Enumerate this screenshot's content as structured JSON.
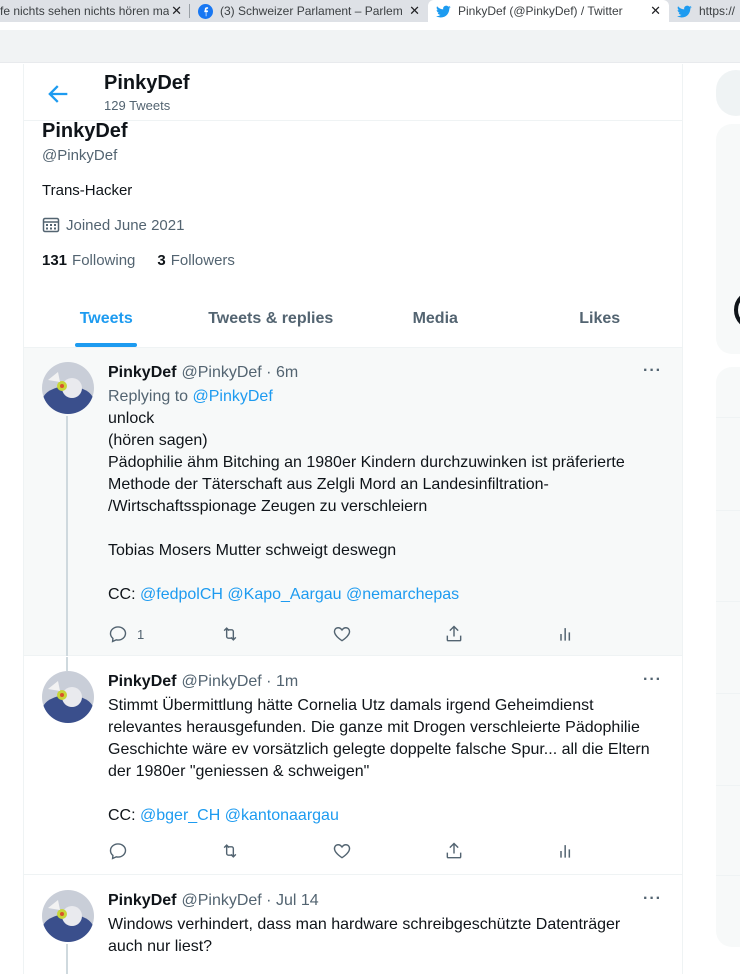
{
  "browser": {
    "tabs": [
      {
        "title": "fe nichts sehen nichts hören ma",
        "active": false
      },
      {
        "title": "(3) Schweizer Parlament – Parlem",
        "active": false,
        "icon": "facebook-icon"
      },
      {
        "title": "PinkyDef (@PinkyDef) / Twitter",
        "active": true,
        "icon": "twitter-icon"
      },
      {
        "title": "https://",
        "active": false,
        "icon": "twitter-icon"
      }
    ]
  },
  "header": {
    "name": "PinkyDef",
    "tweet_count": "129 Tweets"
  },
  "profile": {
    "name": "PinkyDef",
    "handle": "@PinkyDef",
    "bio": "Trans-Hacker",
    "joined": "Joined June 2021",
    "following_count": "131",
    "following_label": "Following",
    "followers_count": "3",
    "followers_label": "Followers"
  },
  "tabs": [
    "Tweets",
    "Tweets & replies",
    "Media",
    "Likes"
  ],
  "tweets": [
    {
      "name": "PinkyDef",
      "meta": "@PinkyDef · 6m",
      "replying_prefix": "Replying to ",
      "replying_to": "@PinkyDef",
      "lines": [
        "unlock",
        "(hören sagen)",
        "Pädophilie ähm Bitching an 1980er Kindern durchzuwinken ist präferierte",
        "Methode der Täterschaft aus Zelgli Mord an Landesinfiltration-",
        "/Wirtschaftsspionage Zeugen zu verschleiern",
        "",
        "Tobias Mosers Mutter schweigt deswegn",
        ""
      ],
      "cc_prefix": "CC: ",
      "mentions": [
        "@fedpolCH",
        "@Kapo_Aargau",
        "@nemarchepas"
      ],
      "reply_count": "1"
    },
    {
      "name": "PinkyDef",
      "meta": "@PinkyDef · 1m",
      "lines": [
        "Stimmt Übermittlung hätte Cornelia Utz damals irgend Geheimdienst",
        "relevantes herausgefunden. Die ganze mit Drogen verschleierte Pädophilie",
        "Geschichte wäre ev vorsätzlich gelegte doppelte falsche Spur... all die Eltern",
        "der 1980er \"geniessen & schweigen\"",
        ""
      ],
      "cc_prefix": "CC: ",
      "mentions": [
        "@bger_CH",
        "@kantonaargau"
      ]
    },
    {
      "name": "PinkyDef",
      "meta": "@PinkyDef · Jul 14",
      "lines": [
        "Windows verhindert, dass man hardware schreibgeschützte Datenträger",
        "auch nur liest?"
      ]
    }
  ],
  "more_label": "···",
  "colors": {
    "accent": "#1d9bf0",
    "text": "#0f1419",
    "muted": "#536471"
  }
}
